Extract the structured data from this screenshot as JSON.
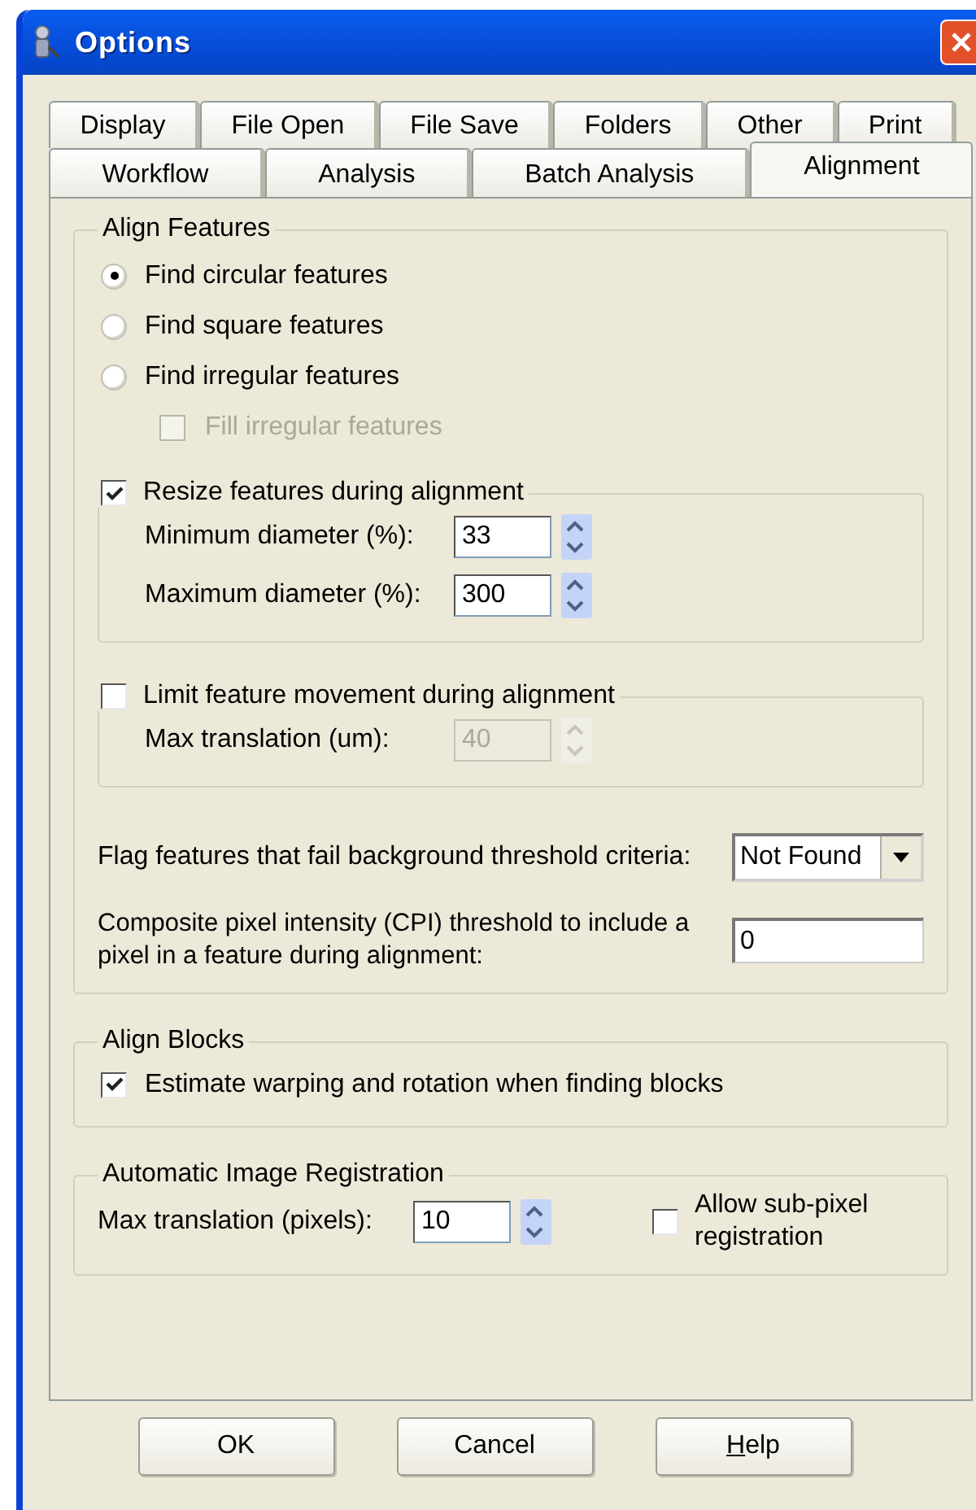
{
  "window": {
    "title": "Options"
  },
  "tab_rows": [
    {
      "tabs": [
        {
          "label": "Display",
          "selected": false
        },
        {
          "label": "File Open",
          "selected": false
        },
        {
          "label": "File Save",
          "selected": false
        },
        {
          "label": "Folders",
          "selected": false
        },
        {
          "label": "Other",
          "selected": false
        },
        {
          "label": "Print",
          "selected": false
        }
      ]
    },
    {
      "tabs": [
        {
          "label": "Workflow",
          "selected": false
        },
        {
          "label": "Analysis",
          "selected": false
        },
        {
          "label": "Batch Analysis",
          "selected": false
        },
        {
          "label": "Alignment",
          "selected": true
        }
      ]
    }
  ],
  "align_features": {
    "title": "Align Features",
    "radios": [
      {
        "label": "Find circular features",
        "selected": true
      },
      {
        "label": "Find square features",
        "selected": false
      },
      {
        "label": "Find irregular features",
        "selected": false
      }
    ],
    "fill_irregular": {
      "label": "Fill irregular features",
      "checked": false,
      "disabled": true
    },
    "resize": {
      "label": "Resize features during alignment",
      "checked": true,
      "fields": [
        {
          "label": "Minimum diameter (%):",
          "value": "33",
          "disabled": false
        },
        {
          "label": "Maximum diameter (%):",
          "value": "300",
          "disabled": false
        }
      ]
    },
    "limit": {
      "label": "Limit feature movement during alignment",
      "checked": false,
      "fields": [
        {
          "label": "Max translation (um):",
          "value": "40",
          "disabled": true
        }
      ]
    },
    "flag": {
      "label": "Flag features that fail background threshold criteria:",
      "value": "Not Found"
    },
    "cpi": {
      "label": "Composite pixel intensity (CPI) threshold to include a pixel in a feature during alignment:",
      "value": "0"
    }
  },
  "align_blocks": {
    "title": "Align Blocks",
    "checkbox": {
      "label": "Estimate warping and rotation when finding blocks",
      "checked": true
    }
  },
  "registration": {
    "title": "Automatic Image Registration",
    "field": {
      "label": "Max translation (pixels):",
      "value": "10"
    },
    "checkbox": {
      "label": "Allow sub-pixel registration",
      "checked": false
    }
  },
  "buttons": [
    {
      "label": "OK",
      "underline_first": false
    },
    {
      "label": "Cancel",
      "underline_first": false
    },
    {
      "label": "Help",
      "underline_first": true
    }
  ]
}
